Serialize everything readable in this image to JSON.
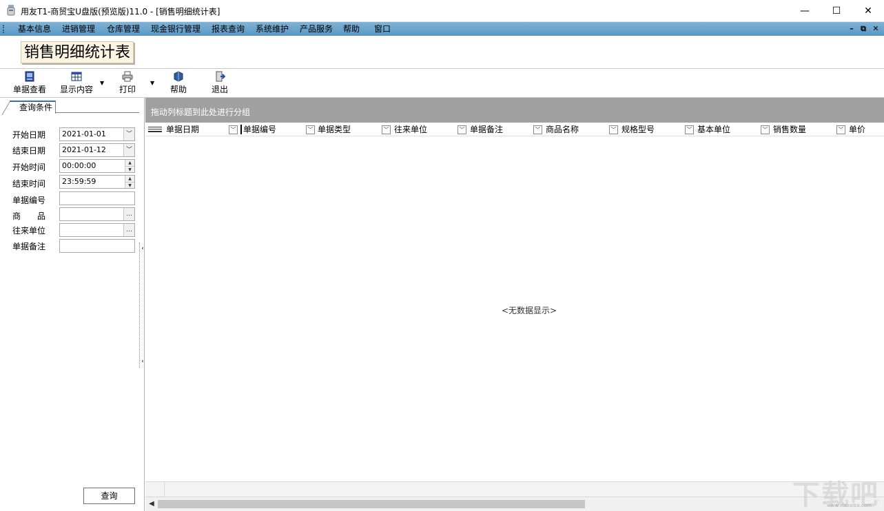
{
  "window": {
    "title": "用友T1-商贸宝U盘版(预览版)11.0 - [销售明细统计表]",
    "minimize": "—",
    "maximize": "☐",
    "close": "✕"
  },
  "menu": {
    "items": [
      "基本信息",
      "进销管理",
      "仓库管理",
      "现金银行管理",
      "报表查询",
      "系统维护",
      "产品服务",
      "帮助",
      "窗口"
    ],
    "mdi_minimize": "–",
    "mdi_restore": "⧉",
    "mdi_close": "✕"
  },
  "form": {
    "title": "销售明细统计表"
  },
  "toolbar": {
    "view_doc": "单据查看",
    "display_content": "显示内容",
    "print": "打印",
    "help": "帮助",
    "exit": "退出"
  },
  "query_panel": {
    "tab_label": "查询条件",
    "fields": {
      "start_date": {
        "label": "开始日期",
        "value": "2021-01-01"
      },
      "end_date": {
        "label": "结束日期",
        "value": "2021-01-12"
      },
      "start_time": {
        "label": "开始时间",
        "value": "00:00:00"
      },
      "end_time": {
        "label": "结束时间",
        "value": "23:59:59"
      },
      "doc_number": {
        "label": "单据编号",
        "value": ""
      },
      "product": {
        "label": "商　　品",
        "value": ""
      },
      "partner": {
        "label": "往来单位",
        "value": ""
      },
      "doc_note": {
        "label": "单据备注",
        "value": ""
      }
    },
    "query_button": "查询"
  },
  "grid": {
    "group_hint": "拖动列标题到此处进行分组",
    "columns": [
      "单据日期",
      "单据编号",
      "单据类型",
      "往来单位",
      "单据备注",
      "商品名称",
      "规格型号",
      "基本单位",
      "销售数量",
      "单价"
    ],
    "empty_message": "<无数据显示>"
  },
  "watermark": {
    "text": "下载吧",
    "url": "www.xiazaiba.com"
  }
}
